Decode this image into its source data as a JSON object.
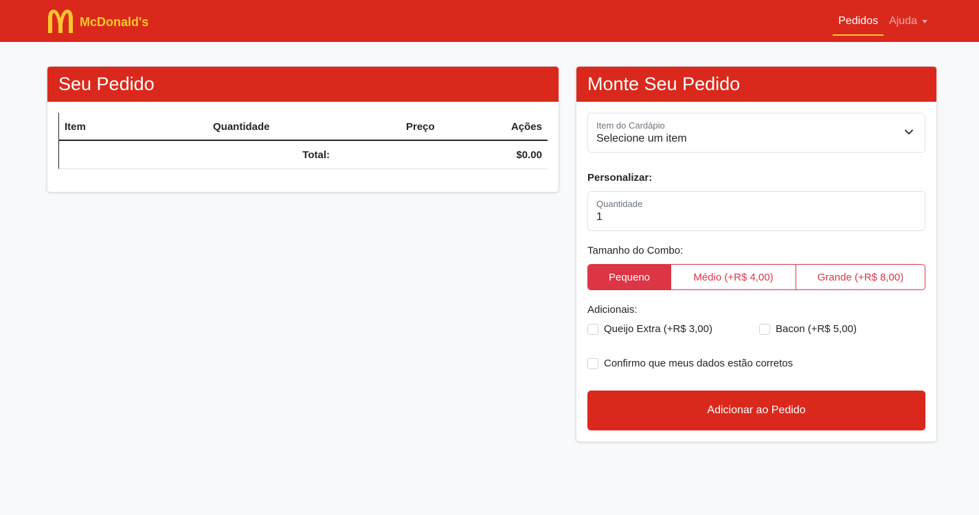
{
  "brand": {
    "name": "McDonald's",
    "logo_icon": "golden-arches-icon"
  },
  "nav": {
    "pedidos": "Pedidos",
    "ajuda": "Ajuda"
  },
  "order": {
    "title": "Seu Pedido",
    "columns": {
      "item": "Item",
      "quantity": "Quantidade",
      "price": "Preço",
      "actions": "Ações"
    },
    "total_label": "Total:",
    "total_value": "$0.00"
  },
  "builder": {
    "title": "Monte Seu Pedido",
    "menu_item": {
      "label": "Item do Cardápio",
      "value": "Selecione um item"
    },
    "customize_label": "Personalizar:",
    "quantity": {
      "label": "Quantidade",
      "value": "1"
    },
    "combo_label": "Tamanho do Combo:",
    "combo_options": [
      "Pequeno",
      "Médio (+R$ 4,00)",
      "Grande (+R$ 8,00)"
    ],
    "combo_selected": "Pequeno",
    "addons_label": "Adicionais:",
    "addons": [
      "Queijo Extra (+R$ 3,00)",
      "Bacon (+R$ 5,00)"
    ],
    "confirm_label": "Confirmo que meus dados estão corretos",
    "submit_label": "Adicionar ao Pedido"
  },
  "colors": {
    "brand_red": "#da291c",
    "brand_yellow": "#ffc72c",
    "accent_red": "#dc3545"
  }
}
